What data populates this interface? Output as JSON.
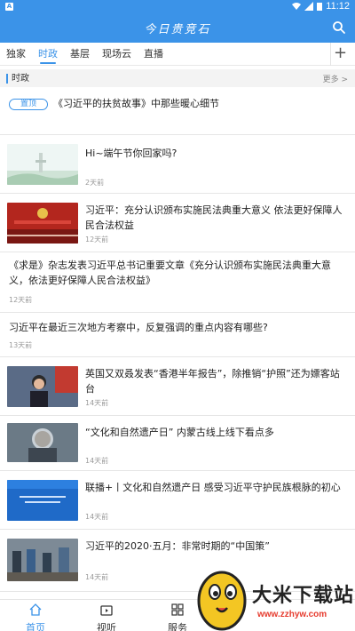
{
  "status_bar": {
    "time": "11:12",
    "left_icon": "A"
  },
  "header": {
    "title": "今日贵竞石"
  },
  "tabs": [
    "独家",
    "时政",
    "基层",
    "现场云",
    "直播"
  ],
  "active_tab": "时政",
  "section": {
    "title": "时政",
    "more": "更多 >"
  },
  "pinned": {
    "badge": "置顶",
    "title": "《习近平的扶贫故事》中那些暖心细节"
  },
  "items": [
    {
      "title": "Hi~端午节你回家吗?",
      "time": "2天前"
    },
    {
      "title": "习近平：充分认识颁布实施民法典重大意义 依法更好保障人民合法权益",
      "time": "12天前"
    },
    {
      "title": "《求是》杂志发表习近平总书记重要文章《充分认识颁布实施民法典重大意义，依法更好保障人民合法权益》",
      "time": "12天前"
    },
    {
      "title": "习近平在最近三次地方考察中，反复强调的重点内容有哪些?",
      "time": "13天前"
    },
    {
      "title": "英国又双叒发表“香港半年报告”，除推销“护照”还为嫖客站台",
      "time": "14天前"
    },
    {
      "title": "“文化和自然遗产日” 内蒙古线上线下看点多",
      "time": "14天前"
    },
    {
      "title": "联播+丨文化和自然遗产日 感受习近平守护民族根脉的初心",
      "time": "14天前"
    },
    {
      "title": "习近平的2020·五月：非常时期的“中国策”",
      "time": "14天前"
    }
  ],
  "bottom_nav": [
    "首页",
    "视听",
    "服务"
  ],
  "icons": [
    "search-icon",
    "add-icon",
    "home-icon",
    "video-icon",
    "grid-icon"
  ],
  "colors": {
    "accent": "#3b93e8"
  },
  "watermark": {
    "text": "大米下载站",
    "url": "www.zzhyw.com"
  }
}
